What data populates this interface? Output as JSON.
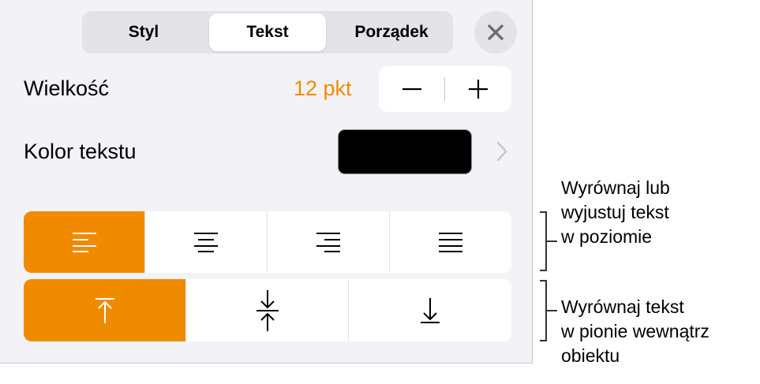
{
  "tabs": [
    {
      "label": "Styl",
      "active": false
    },
    {
      "label": "Tekst",
      "active": true
    },
    {
      "label": "Porządek",
      "active": false
    }
  ],
  "close_icon": "close-icon",
  "size": {
    "label": "Wielkość",
    "value": "12 pkt",
    "decrement_icon": "minus-icon",
    "increment_icon": "plus-icon"
  },
  "text_color": {
    "label": "Kolor tekstu",
    "swatch": "#000000",
    "chevron_icon": "chevron-right-icon"
  },
  "horizontal_alignment": {
    "options": [
      "align-left-icon",
      "align-center-icon",
      "align-right-icon",
      "justify-icon"
    ],
    "selected": 0
  },
  "vertical_alignment": {
    "options": [
      "align-top-icon",
      "align-middle-icon",
      "align-bottom-icon"
    ],
    "selected": 0
  },
  "callouts": {
    "horizontal": [
      "Wyrównaj lub",
      "wyjustuj tekst",
      "w poziomie"
    ],
    "vertical": [
      "Wyrównaj tekst",
      "w pionie wewnątrz",
      "obiektu"
    ]
  },
  "colors": {
    "accent": "#f08b00",
    "panel_bg": "#f2f2f7",
    "segment_bg": "#e3e3e8"
  }
}
